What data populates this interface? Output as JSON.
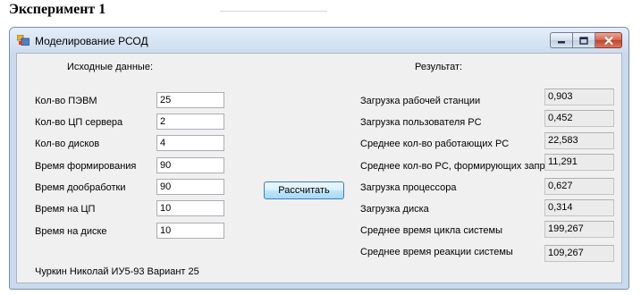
{
  "doc": {
    "heading": "Эксперимент 1"
  },
  "window": {
    "title": "Моделирование РСОД",
    "controls": {
      "minimize": "minimize-icon",
      "maximize": "maximize-icon",
      "close": "close-icon"
    }
  },
  "inputs": {
    "header": "Исходные данные:",
    "fields": [
      {
        "label": "Кол-во ПЭВМ",
        "value": "25"
      },
      {
        "label": "Кол-во ЦП сервера",
        "value": "2"
      },
      {
        "label": "Кол-во дисков",
        "value": "4"
      },
      {
        "label": "Время формирования",
        "value": "90"
      },
      {
        "label": "Время дообработки",
        "value": "90"
      },
      {
        "label": "Время на ЦП",
        "value": "10"
      },
      {
        "label": "Время на диске",
        "value": "10"
      }
    ]
  },
  "actions": {
    "calculate_label": "Рассчитать"
  },
  "results": {
    "header": "Результат:",
    "fields": [
      {
        "label": "Загрузка рабочей станции",
        "value": "0,903"
      },
      {
        "label": "Загрузка пользователя PC",
        "value": "0,452"
      },
      {
        "label": "Среднее кол-во работающих PC",
        "value": "22,583"
      },
      {
        "label": "Среднее кол-во PC, формирующих запрос",
        "value": "11,291"
      },
      {
        "label": "Загрузка процессора",
        "value": "0,627"
      },
      {
        "label": "Загрузка диска",
        "value": "0,314"
      },
      {
        "label": "Среднее время цикла системы",
        "value": "199,267"
      },
      {
        "label": "Среднее время реакции системы",
        "value": "109,267"
      }
    ]
  },
  "footer": {
    "author": "Чуркин Николай ИУ5-93 Вариант 25"
  }
}
